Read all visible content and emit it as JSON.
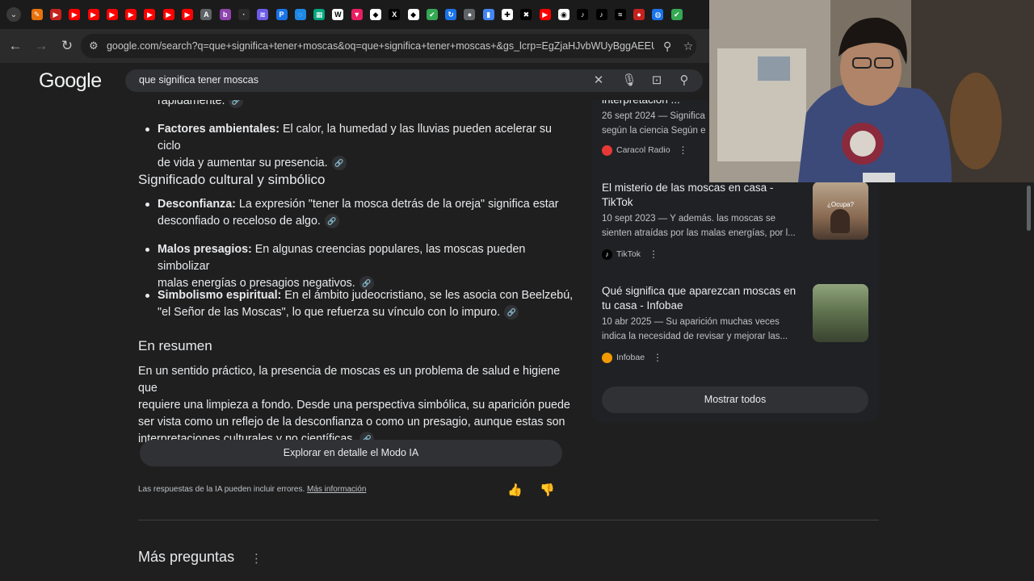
{
  "tabs": {
    "favicons": [
      {
        "icon": "firefox-like-icon",
        "color": "#e8710a",
        "glyph": "✎"
      },
      {
        "icon": "arrow-icon",
        "color": "#c5221f",
        "glyph": "▶"
      },
      {
        "icon": "youtube-icon",
        "color": "#ff0000",
        "glyph": "▶"
      },
      {
        "icon": "youtube-icon",
        "color": "#ff0000",
        "glyph": "▶"
      },
      {
        "icon": "youtube-icon",
        "color": "#ff0000",
        "glyph": "▶"
      },
      {
        "icon": "youtube-icon",
        "color": "#ff0000",
        "glyph": "▶"
      },
      {
        "icon": "youtube-icon",
        "color": "#ff0000",
        "glyph": "▶"
      },
      {
        "icon": "youtube-icon",
        "color": "#ff0000",
        "glyph": "▶"
      },
      {
        "icon": "youtube-icon",
        "color": "#ff0000",
        "glyph": "▶"
      },
      {
        "icon": "translate-icon",
        "color": "#5f6368",
        "glyph": "A"
      },
      {
        "icon": "b-icon",
        "color": "#8e44ad",
        "glyph": "b"
      },
      {
        "icon": "dot-icon",
        "color": "#2b2b2b",
        "glyph": "·"
      },
      {
        "icon": "layers-icon",
        "color": "#6c5ce7",
        "glyph": "≋"
      },
      {
        "icon": "p-icon",
        "color": "#1a73e8",
        "glyph": "P"
      },
      {
        "icon": "edge-icon",
        "color": "#1e88e5",
        "glyph": "◌"
      },
      {
        "icon": "grid-icon",
        "color": "#00a67e",
        "glyph": "▦"
      },
      {
        "icon": "w-icon",
        "color": "#ffffff",
        "glyph": "W"
      },
      {
        "icon": "bookmark-icon",
        "color": "#e91e63",
        "glyph": "▼"
      },
      {
        "icon": "diamond-icon",
        "color": "#ffffff",
        "glyph": "◆"
      },
      {
        "icon": "x-icon",
        "color": "#000000",
        "glyph": "X"
      },
      {
        "icon": "diamond-icon",
        "color": "#ffffff",
        "glyph": "◆"
      },
      {
        "icon": "check-icon",
        "color": "#34a853",
        "glyph": "✔"
      },
      {
        "icon": "sync-icon",
        "color": "#1a73e8",
        "glyph": "↻"
      },
      {
        "icon": "chat-icon",
        "color": "#5f6368",
        "glyph": "●"
      },
      {
        "icon": "chart-icon",
        "color": "#4285f4",
        "glyph": "▮"
      },
      {
        "icon": "puzzle-icon",
        "color": "#ffffff",
        "glyph": "✚"
      },
      {
        "icon": "x-icon",
        "color": "#000000",
        "glyph": "✖"
      },
      {
        "icon": "youtube-icon",
        "color": "#ff0000",
        "glyph": "▶"
      },
      {
        "icon": "chrome-icon",
        "color": "#ffffff",
        "glyph": "◉"
      },
      {
        "icon": "tiktok-icon",
        "color": "#000000",
        "glyph": "♪"
      },
      {
        "icon": "tiktok-icon",
        "color": "#000000",
        "glyph": "♪"
      },
      {
        "icon": "x-icon",
        "color": "#000000",
        "glyph": "≈"
      },
      {
        "icon": "record-icon",
        "color": "#c5221f",
        "glyph": "●"
      },
      {
        "icon": "globe-icon",
        "color": "#1a73e8",
        "glyph": "◍"
      },
      {
        "icon": "check-icon",
        "color": "#34a853",
        "glyph": "✔"
      }
    ]
  },
  "toolbar": {
    "url": "google.com/search?q=que+significa+tener+moscas&oq=que+significa+tener+moscas+&gs_lcrp=EgZjaHJvbWUyBggAEEUYOTIH..."
  },
  "google": {
    "logo": "Google",
    "query": "que significa tener moscas"
  },
  "ai": {
    "partial_top": "rápidamente.",
    "bullets_a": [
      {
        "title": "Factores ambientales:",
        "text": " El calor, la humedad y las lluvias pueden acelerar su ciclo",
        "text2": "de vida y aumentar su presencia."
      }
    ],
    "heading_cultural": "Significado cultural y simbólico",
    "bullets_b": [
      {
        "title": "Desconfianza:",
        "text": " La expresión \"tener la mosca detrás de la oreja\" significa estar",
        "text2": "desconfiado o receloso de algo."
      },
      {
        "title": "Malos presagios:",
        "text": " En algunas creencias populares, las moscas pueden simbolizar",
        "text2": "malas energías o presagios negativos."
      },
      {
        "title": "Simbolismo espiritual:",
        "text": " En el ámbito judeocristiano, se les asocia con Beelzebú,",
        "text2": "\"el Señor de las Moscas\", lo que refuerza su vínculo con lo impuro."
      }
    ],
    "heading_summary": "En resumen",
    "summary_lines": [
      "En un sentido práctico, la presencia de moscas es un problema de salud e higiene que",
      "requiere una limpieza a fondo. Desde una perspectiva simbólica, su aparición puede",
      "ser vista como un reflejo de la desconfianza o como un presagio, aunque estas son",
      "interpretaciones culturales y no científicas."
    ],
    "explore_button": "Explorar en detalle el Modo IA",
    "disclaimer": "Las respuestas de la IA pueden incluir errores. ",
    "disclaimer_link": "Más información"
  },
  "sources": {
    "top_partial": {
      "title": "interpretación ...",
      "snippet1": "26 sept 2024 — Significa",
      "snippet2": "según la ciencia Según e",
      "source": "Caracol Radio"
    },
    "items": [
      {
        "title1": "El misterio de las moscas en casa -",
        "title2": "TikTok",
        "snippet1": "10 sept 2023 — Y además. las moscas se",
        "snippet2": "sienten atraídas por las malas energías, por l...",
        "source": "TikTok",
        "thumb_label": "¿Ocupa?"
      },
      {
        "title1": "Qué significa que aparezcan moscas en",
        "title2": "tu casa - Infobae",
        "snippet1": "10 abr 2025 — Su aparición muchas veces",
        "snippet2": "indica la necesidad de revisar y mejorar las...",
        "source": "Infobae"
      }
    ],
    "show_all": "Mostrar todos"
  },
  "more_questions": "Más preguntas",
  "colors": {
    "page_bg": "#1f1f1f",
    "card_bg": "#303134",
    "accent_blue": "#8ab4f8"
  }
}
